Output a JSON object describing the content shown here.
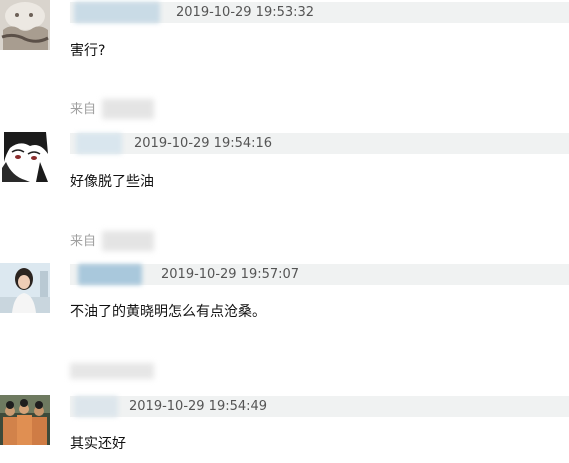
{
  "comments": [
    {
      "timestamp": "2019-10-29 19:53:32",
      "text": "害行?",
      "avatar_icon": "cat-avatar-icon"
    },
    {
      "source_label": "来自",
      "timestamp": "2019-10-29 19:54:16",
      "text": "好像脱了些油",
      "avatar_icon": "anime-avatar-icon"
    },
    {
      "source_label": "来自",
      "timestamp": "2019-10-29 19:57:07",
      "text": "不油了的黄晓明怎么有点沧桑。",
      "avatar_icon": "woman-photo-avatar-icon"
    },
    {
      "timestamp": "2019-10-29 19:54:49",
      "text": "其实还好",
      "avatar_icon": "group-photo-avatar-icon"
    }
  ],
  "colors": {
    "meta_bar_bg": "#f0f2f2",
    "timestamp": "#555555",
    "source_label": "#a0a0a0",
    "body_text": "#111111",
    "blurred_username": "#a9c8dc"
  }
}
